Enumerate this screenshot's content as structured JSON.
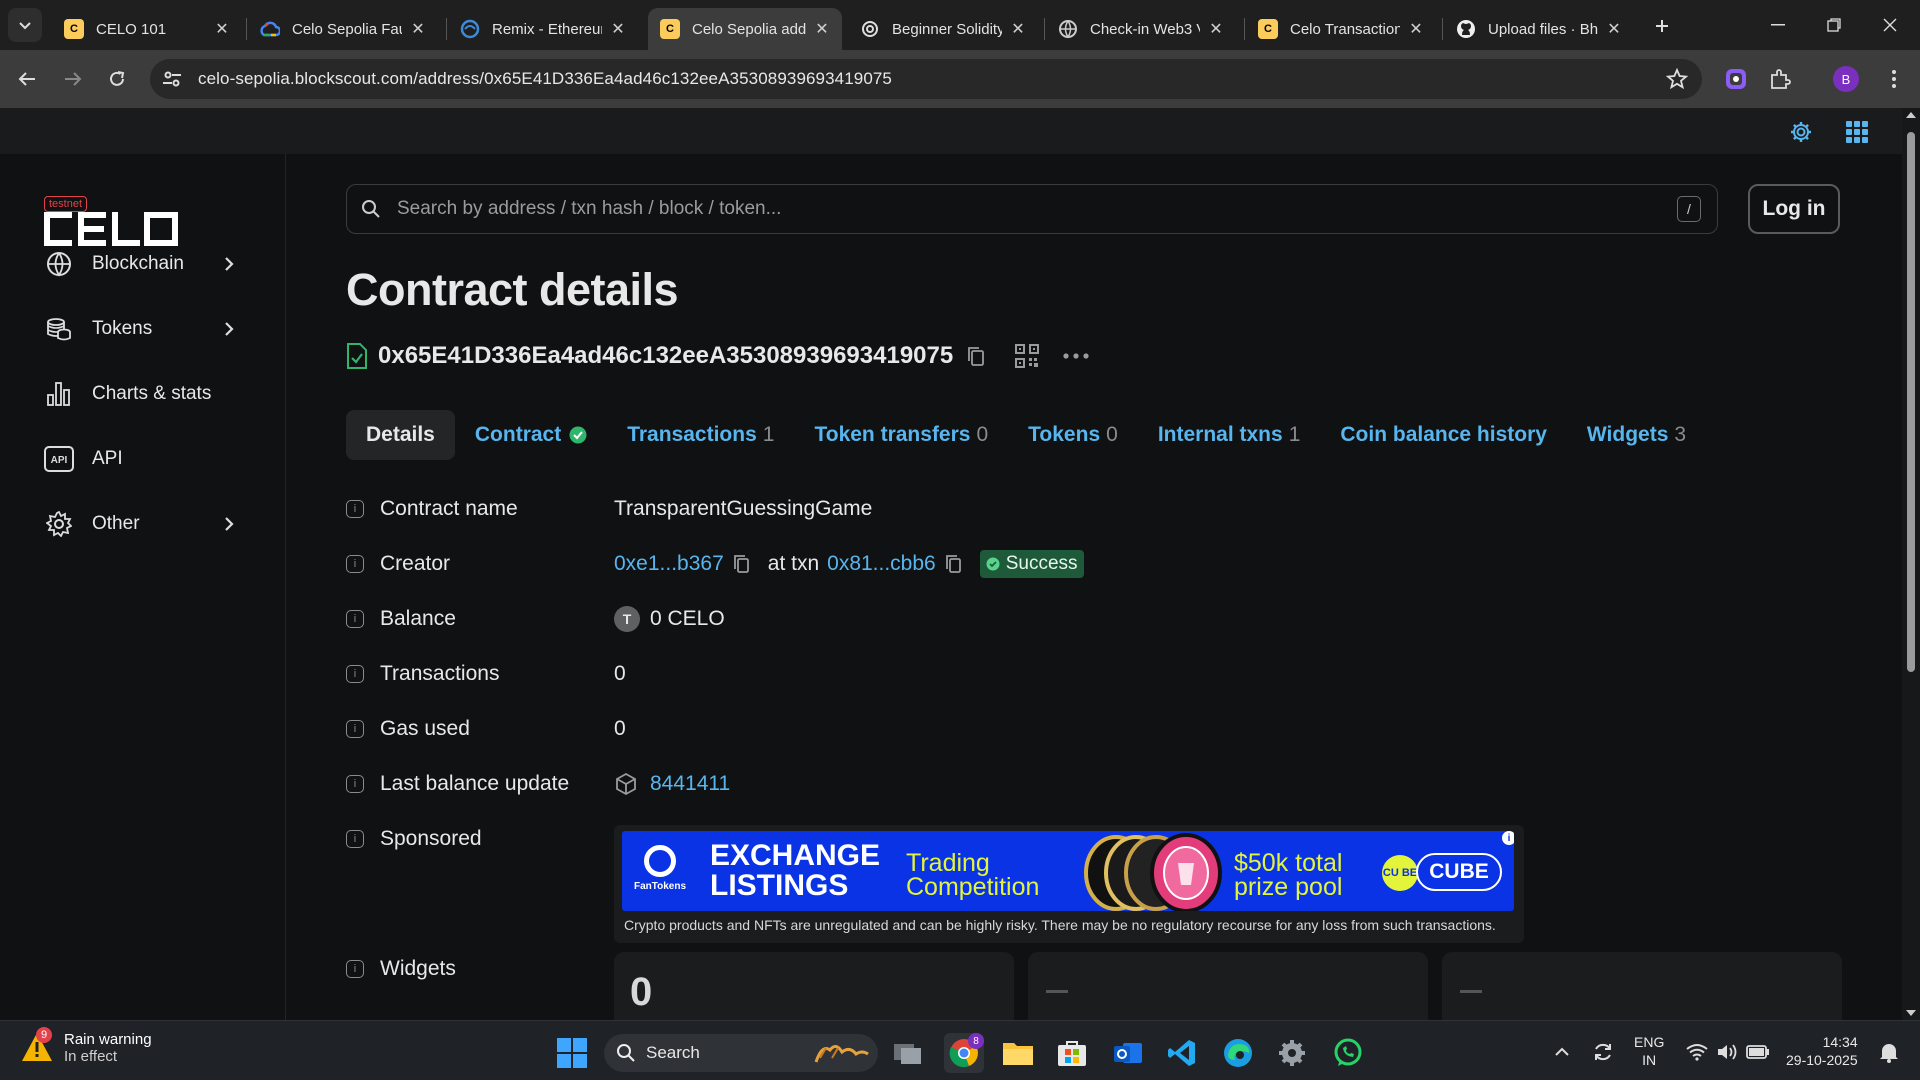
{
  "browser": {
    "tabs": [
      {
        "title": "CELO 101",
        "icon": "celo-favicon",
        "active": false
      },
      {
        "title": "Celo Sepolia Fau",
        "icon": "google-cloud-favicon",
        "active": false
      },
      {
        "title": "Remix - Ethereum",
        "icon": "remix-favicon",
        "active": false
      },
      {
        "title": "Celo Sepolia add",
        "icon": "celo-favicon",
        "active": true
      },
      {
        "title": "Beginner Solidity",
        "icon": "openai-favicon",
        "active": false
      },
      {
        "title": "Check-in Web3 V",
        "icon": "globe-favicon",
        "active": false
      },
      {
        "title": "Celo Transaction",
        "icon": "celo-favicon",
        "active": false
      },
      {
        "title": "Upload files · Bh",
        "icon": "github-favicon",
        "active": false
      }
    ],
    "url": "celo-sepolia.blockscout.com/address/0x65E41D336Ea4ad46c132eeA35308939693419075",
    "profile_initial": "B"
  },
  "sidebar": {
    "testnet_label": "testnet",
    "logo_text": "CELO",
    "items": [
      {
        "label": "Blockchain",
        "icon": "globe-icon",
        "has_submenu": true
      },
      {
        "label": "Tokens",
        "icon": "coins-icon",
        "has_submenu": true
      },
      {
        "label": "Charts & stats",
        "icon": "bar-chart-icon",
        "has_submenu": false
      },
      {
        "label": "API",
        "icon": "api-icon",
        "has_submenu": false
      },
      {
        "label": "Other",
        "icon": "gear-icon",
        "has_submenu": true
      }
    ]
  },
  "search": {
    "placeholder": "Search by address / txn hash / block / token...",
    "shortcut": "/"
  },
  "login_label": "Log in",
  "page": {
    "title": "Contract details",
    "address": "0x65E41D336Ea4ad46c132eeA35308939693419075"
  },
  "tabs": [
    {
      "label": "Contract",
      "count": "",
      "verified": true
    },
    {
      "label": "Transactions",
      "count": "1"
    },
    {
      "label": "Token transfers",
      "count": "0"
    },
    {
      "label": "Tokens",
      "count": "0"
    },
    {
      "label": "Internal txns",
      "count": "1"
    },
    {
      "label": "Coin balance history",
      "count": ""
    },
    {
      "label": "Widgets",
      "count": "3"
    }
  ],
  "details_tab_label": "Details",
  "details": {
    "contract_name": {
      "label": "Contract name",
      "value": "TransparentGuessingGame"
    },
    "creator": {
      "label": "Creator",
      "address": "0xe1...b367",
      "at_txn_text": "at txn",
      "txn": "0x81...cbb6",
      "status": "Success"
    },
    "balance": {
      "label": "Balance",
      "token_letter": "T",
      "value": "0 CELO"
    },
    "transactions": {
      "label": "Transactions",
      "value": "0"
    },
    "gas_used": {
      "label": "Gas used",
      "value": "0"
    },
    "last_balance_update": {
      "label": "Last balance update",
      "value": "8441411"
    },
    "sponsored": {
      "label": "Sponsored"
    },
    "widgets": {
      "label": "Widgets",
      "first_value": "0"
    }
  },
  "ad": {
    "brand": "FanTokens",
    "headline_1": "EXCHANGE",
    "headline_2": "LISTINGS",
    "trading_1": "Trading",
    "trading_2": "Competition",
    "prize_1": "$50k total",
    "prize_2": "prize pool",
    "cube_logo": "CU BE",
    "cube_button": "CUBE",
    "disclaimer": "Crypto products and NFTs are unregulated and can be highly risky. There may be no regulatory recourse for any loss from such transactions."
  },
  "taskbar": {
    "weather_title": "Rain warning",
    "weather_sub": "In effect",
    "weather_badge": "9",
    "search_label": "Search",
    "chrome_badge": "8",
    "lang_1": "ENG",
    "lang_2": "IN",
    "time": "14:34",
    "date": "29-10-2025"
  },
  "colors": {
    "accent_link": "#58b5ee",
    "success_badge": "#1e5a3a",
    "ad_blue": "#0b33e6",
    "ad_yellow": "#e3f53a",
    "testnet_red": "#e4424a"
  }
}
